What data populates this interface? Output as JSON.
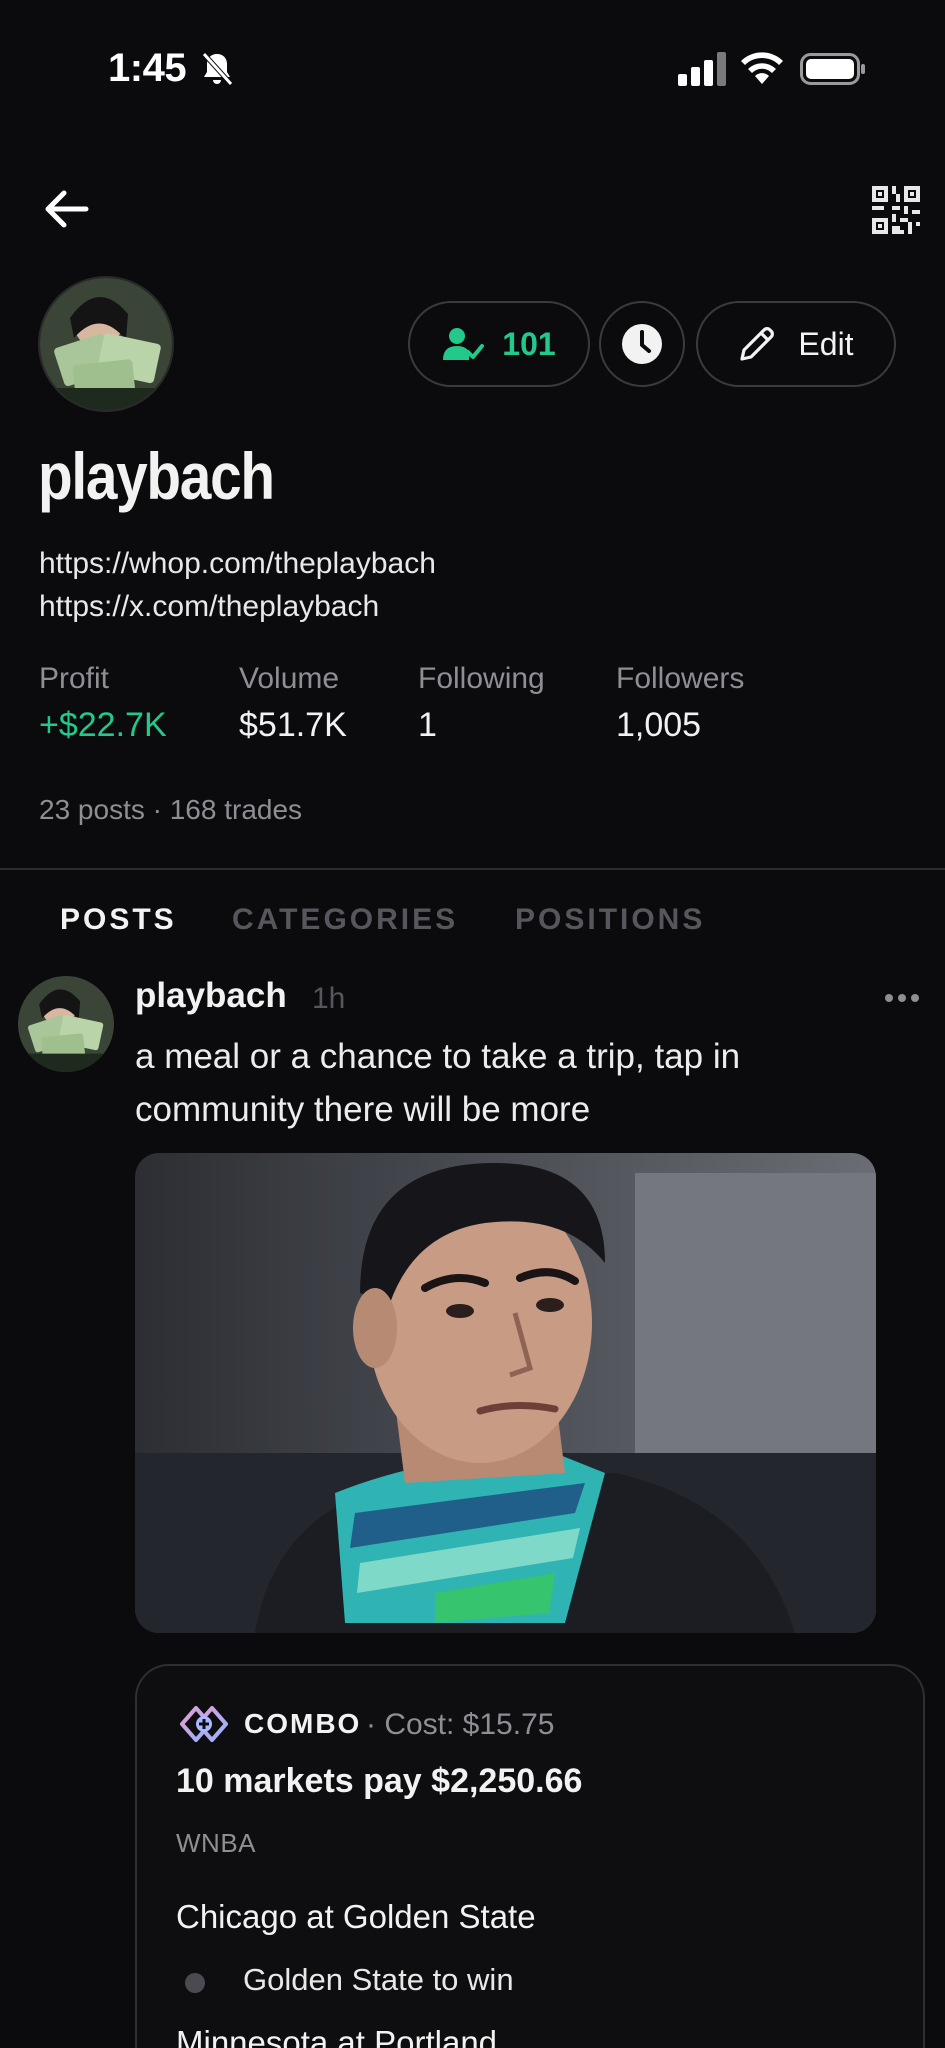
{
  "status_bar": {
    "time": "1:45",
    "icons": [
      "bell-slash-icon",
      "signal-icon",
      "wifi-icon",
      "battery-icon"
    ]
  },
  "nav": {
    "back_icon": "arrow-left-icon",
    "qr_icon": "qr-code-icon"
  },
  "profile": {
    "username": "playbach",
    "links": [
      "https://whop.com/theplaybach",
      "https://x.com/theplaybach"
    ],
    "actions": {
      "followers_count": "101",
      "followers_icon": "person-check-icon",
      "history_icon": "clock-icon",
      "edit_label": "Edit",
      "edit_icon": "pencil-icon"
    },
    "stats": [
      {
        "label": "Profit",
        "value": "+$22.7K"
      },
      {
        "label": "Volume",
        "value": "$51.7K"
      },
      {
        "label": "Following",
        "value": "1"
      },
      {
        "label": "Followers",
        "value": "1,005"
      }
    ],
    "counts": "23 posts · 168 trades"
  },
  "tabs": [
    {
      "label": "POSTS",
      "active": true
    },
    {
      "label": "CATEGORIES",
      "active": false
    },
    {
      "label": "POSITIONS",
      "active": false
    }
  ],
  "post": {
    "author": "playbach",
    "time": "1h",
    "text": "a meal or a chance to take a trip, tap in community there will be more",
    "combo": {
      "label": "COMBO",
      "cost": "· Cost: $15.75",
      "title": "10 markets pay $2,250.66",
      "league": "WNBA",
      "games": [
        {
          "title": "Chicago at Golden State",
          "pick": "Golden State to win"
        },
        {
          "title": "Minnesota at Portland"
        }
      ]
    }
  },
  "colors": {
    "background": "#0b0b0e",
    "accent_green": "#22c98a",
    "muted": "#8e8e93"
  }
}
